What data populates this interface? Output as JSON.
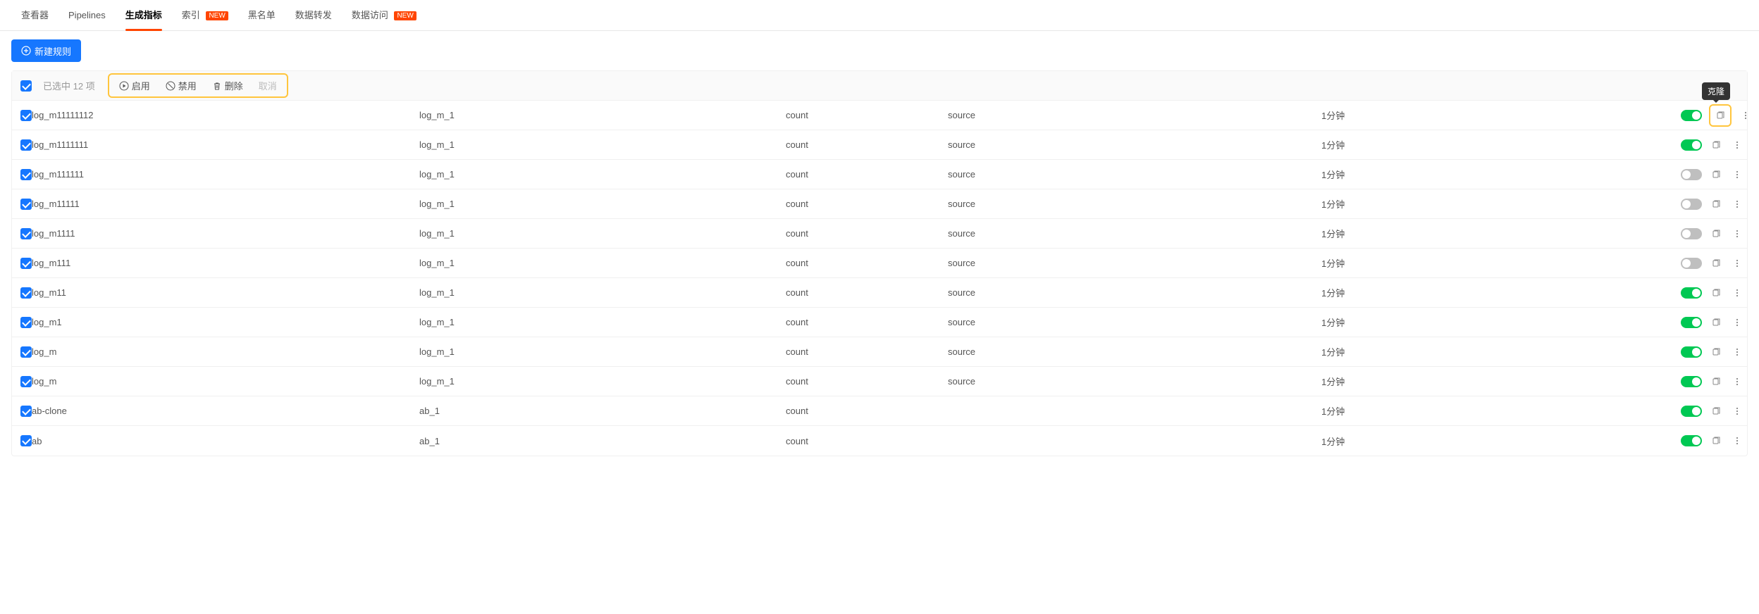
{
  "tabs": {
    "viewer": "查看器",
    "pipelines": "Pipelines",
    "metrics": "生成指标",
    "index": "索引",
    "blacklist": "黑名单",
    "forward": "数据转发",
    "access": "数据访问",
    "new_badge": "NEW"
  },
  "toolbar": {
    "new_rule": "新建规则"
  },
  "bulk": {
    "selected_prefix": "已选中",
    "selected_count": "12",
    "selected_suffix": "项",
    "enable": "启用",
    "disable": "禁用",
    "delete": "删除",
    "cancel": "取消"
  },
  "tooltip": {
    "clone": "克隆"
  },
  "rows": [
    {
      "name": "log_m11111112",
      "metric": "log_m_1",
      "op": "count",
      "dim": "source",
      "time": "1分钟",
      "on": true,
      "tooltip": true,
      "highlight": true
    },
    {
      "name": "log_m1111111",
      "metric": "log_m_1",
      "op": "count",
      "dim": "source",
      "time": "1分钟",
      "on": true,
      "tooltip": false,
      "highlight": false
    },
    {
      "name": "log_m111111",
      "metric": "log_m_1",
      "op": "count",
      "dim": "source",
      "time": "1分钟",
      "on": false,
      "tooltip": false,
      "highlight": false
    },
    {
      "name": "log_m11111",
      "metric": "log_m_1",
      "op": "count",
      "dim": "source",
      "time": "1分钟",
      "on": false,
      "tooltip": false,
      "highlight": false
    },
    {
      "name": "log_m1111",
      "metric": "log_m_1",
      "op": "count",
      "dim": "source",
      "time": "1分钟",
      "on": false,
      "tooltip": false,
      "highlight": false
    },
    {
      "name": "log_m111",
      "metric": "log_m_1",
      "op": "count",
      "dim": "source",
      "time": "1分钟",
      "on": false,
      "tooltip": false,
      "highlight": false
    },
    {
      "name": "log_m11",
      "metric": "log_m_1",
      "op": "count",
      "dim": "source",
      "time": "1分钟",
      "on": true,
      "tooltip": false,
      "highlight": false
    },
    {
      "name": "log_m1",
      "metric": "log_m_1",
      "op": "count",
      "dim": "source",
      "time": "1分钟",
      "on": true,
      "tooltip": false,
      "highlight": false
    },
    {
      "name": "log_m",
      "metric": "log_m_1",
      "op": "count",
      "dim": "source",
      "time": "1分钟",
      "on": true,
      "tooltip": false,
      "highlight": false
    },
    {
      "name": "log_m",
      "metric": "log_m_1",
      "op": "count",
      "dim": "source",
      "time": "1分钟",
      "on": true,
      "tooltip": false,
      "highlight": false
    },
    {
      "name": "ab-clone",
      "metric": "ab_1",
      "op": "count",
      "dim": "",
      "time": "1分钟",
      "on": true,
      "tooltip": false,
      "highlight": false
    },
    {
      "name": "ab",
      "metric": "ab_1",
      "op": "count",
      "dim": "",
      "time": "1分钟",
      "on": true,
      "tooltip": false,
      "highlight": false
    }
  ]
}
